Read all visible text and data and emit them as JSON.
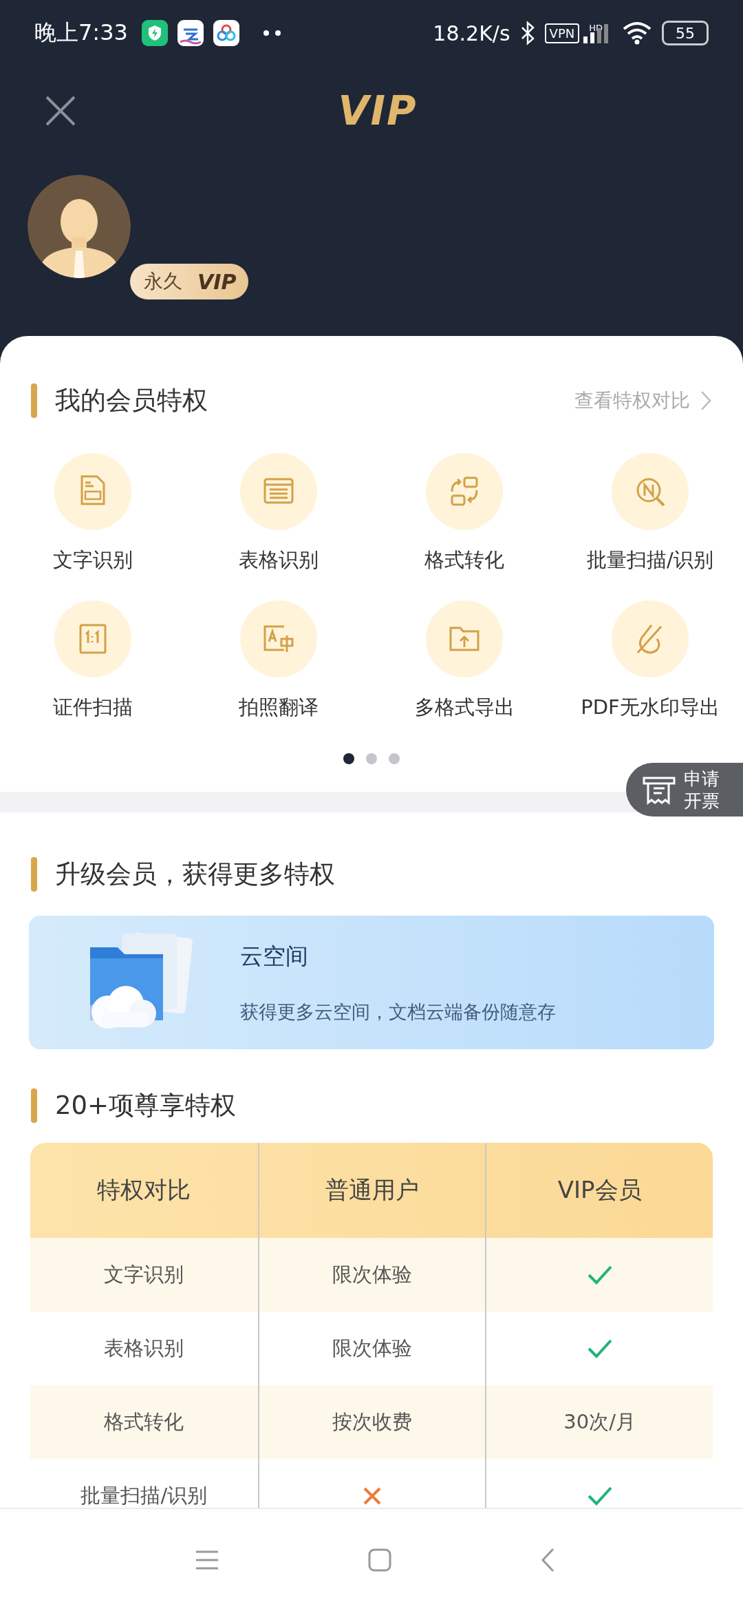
{
  "status_bar": {
    "time": "晚上7:33",
    "speed": "18.2K/s",
    "vpn": "VPN",
    "network": "HD",
    "battery": "55"
  },
  "header": {
    "logo": "VIP"
  },
  "profile": {
    "badge_label": "永久",
    "badge_tier": "VIP"
  },
  "my_privileges": {
    "title": "我的会员特权",
    "link": "查看特权对比",
    "items": [
      {
        "label": "文字识别"
      },
      {
        "label": "表格识别"
      },
      {
        "label": "格式转化"
      },
      {
        "label": "批量扫描/识别"
      },
      {
        "label": "证件扫描"
      },
      {
        "label": "拍照翻译"
      },
      {
        "label": "多格式导出"
      },
      {
        "label": "PDF无水印导出"
      }
    ],
    "pages": [
      {
        "selected": true
      },
      {
        "selected": false
      },
      {
        "selected": false
      }
    ]
  },
  "invoice_button": {
    "label": "申请开票"
  },
  "upgrade": {
    "title": "升级会员，获得更多特权",
    "card": {
      "title": "云空间",
      "description": "获得更多云空间，文档云端备份随意存"
    }
  },
  "comparison": {
    "title": "20+项尊享特权",
    "columns": [
      "特权对比",
      "普通用户",
      "VIP会员"
    ],
    "rows": [
      [
        {
          "kind": "text",
          "text": "文字识别"
        },
        {
          "kind": "text",
          "text": "限次体验"
        },
        {
          "kind": "check"
        }
      ],
      [
        {
          "kind": "text",
          "text": "表格识别"
        },
        {
          "kind": "text",
          "text": "限次体验"
        },
        {
          "kind": "check"
        }
      ],
      [
        {
          "kind": "text",
          "text": "格式转化"
        },
        {
          "kind": "text",
          "text": "按次收费"
        },
        {
          "kind": "text",
          "text": "30次/月"
        }
      ],
      [
        {
          "kind": "text",
          "text": "批量扫描/识别"
        },
        {
          "kind": "cross"
        },
        {
          "kind": "check"
        }
      ]
    ]
  }
}
